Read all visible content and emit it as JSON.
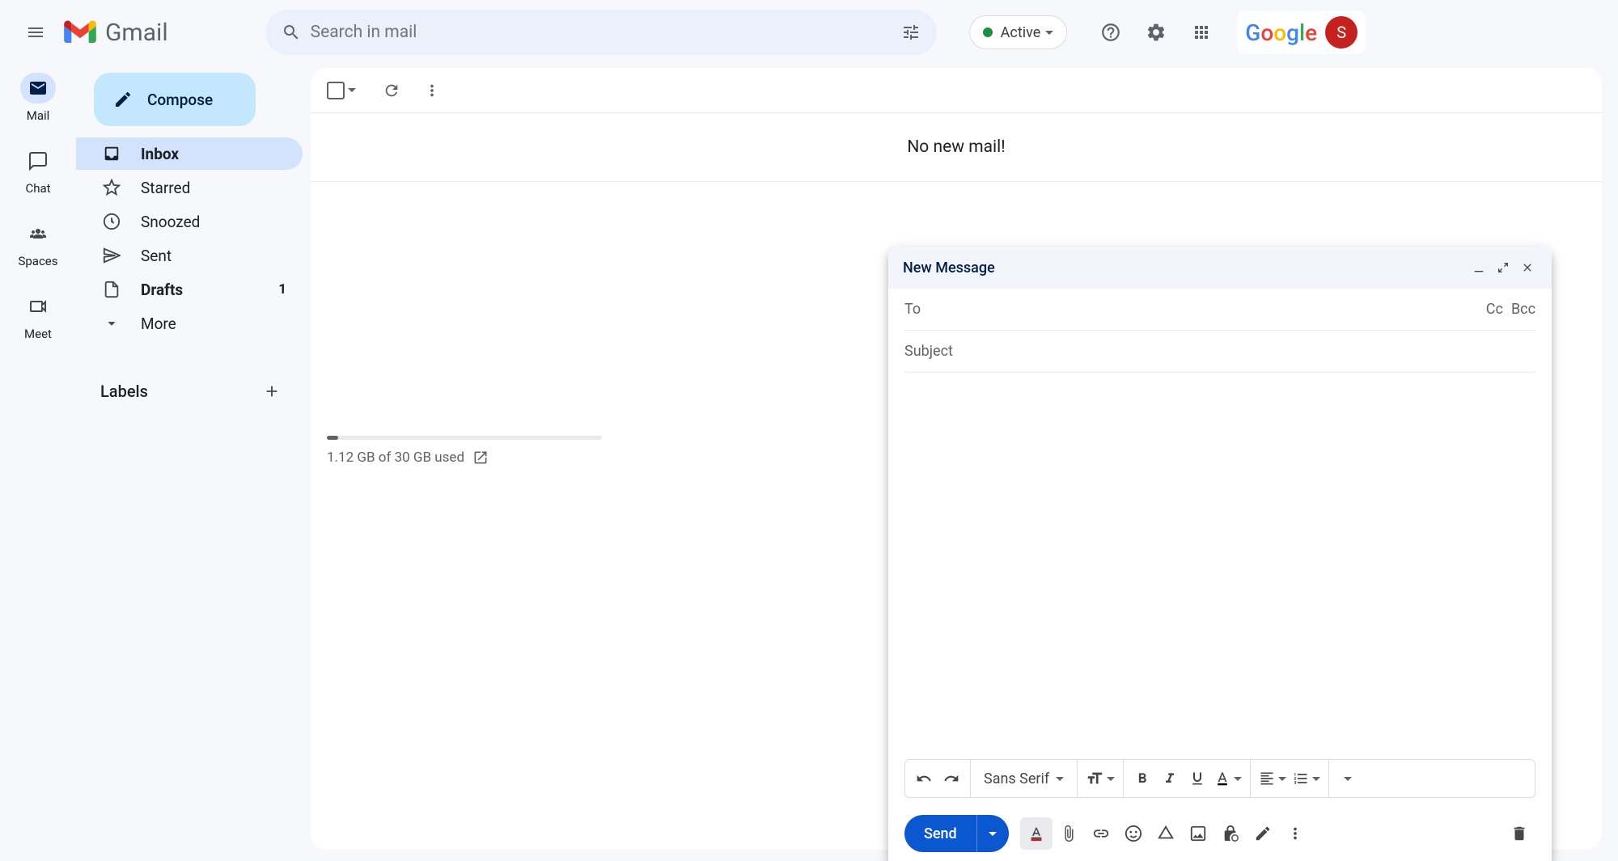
{
  "header": {
    "app_name": "Gmail",
    "search_placeholder": "Search in mail",
    "status_label": "Active",
    "google_brand": "Google",
    "avatar_initial": "S"
  },
  "rail": {
    "items": [
      {
        "label": "Mail"
      },
      {
        "label": "Chat"
      },
      {
        "label": "Spaces"
      },
      {
        "label": "Meet"
      }
    ]
  },
  "sidebar": {
    "compose_label": "Compose",
    "items": [
      {
        "label": "Inbox",
        "count": ""
      },
      {
        "label": "Starred",
        "count": ""
      },
      {
        "label": "Snoozed",
        "count": ""
      },
      {
        "label": "Sent",
        "count": ""
      },
      {
        "label": "Drafts",
        "count": "1"
      },
      {
        "label": "More",
        "count": ""
      }
    ],
    "labels_heading": "Labels"
  },
  "main": {
    "empty_message": "No new mail!",
    "storage_text": "1.12 GB of 30 GB used"
  },
  "compose": {
    "title": "New Message",
    "to_label": "To",
    "cc_label": "Cc",
    "bcc_label": "Bcc",
    "subject_placeholder": "Subject",
    "font_name": "Sans Serif",
    "send_label": "Send"
  }
}
